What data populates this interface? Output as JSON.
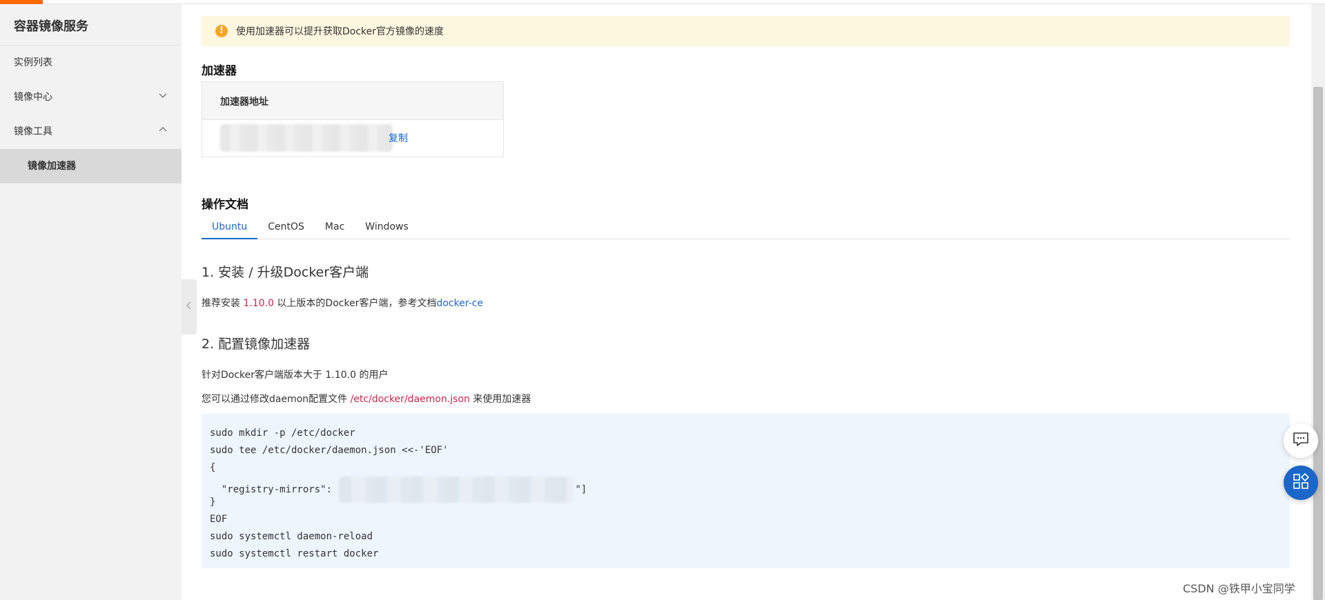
{
  "sidebar": {
    "title": "容器镜像服务",
    "items": [
      {
        "label": "实例列表"
      },
      {
        "label": "镜像中心",
        "chevron": "chevron-down-icon"
      },
      {
        "label": "镜像工具",
        "chevron": "chevron-up-icon"
      }
    ],
    "sub_item": "镜像加速器"
  },
  "alert": {
    "text": "使用加速器可以提升获取Docker官方镜像的速度",
    "icon": "!"
  },
  "accelerator": {
    "heading": "加速器",
    "table_header": "加速器地址",
    "copy_label": "复制"
  },
  "docs": {
    "heading": "操作文档",
    "tabs": [
      "Ubuntu",
      "CentOS",
      "Mac",
      "Windows"
    ],
    "step1": {
      "title": "1. 安装 / 升级Docker客户端",
      "prefix": "推荐安装 ",
      "version": "1.10.0",
      "middle": " 以上版本的Docker客户端，参考文档",
      "link": "docker-ce"
    },
    "step2": {
      "title": "2. 配置镜像加速器",
      "line1": "针对Docker客户端版本大于 1.10.0 的用户",
      "line2_prefix": "您可以通过修改daemon配置文件 ",
      "line2_path": "/etc/docker/daemon.json",
      "line2_suffix": " 来使用加速器"
    },
    "code": {
      "l1": "sudo mkdir -p /etc/docker",
      "l2": "sudo tee /etc/docker/daemon.json <<-'EOF'",
      "l3": "{",
      "l4_prefix": "  \"registry-mirrors\": ",
      "l4_suffix": "\"]",
      "l5": "}",
      "l6": "EOF",
      "l7": "sudo systemctl daemon-reload",
      "l8": "sudo systemctl restart docker"
    }
  },
  "watermark": "CSDN @铁甲小宝同学",
  "colors": {
    "accent": "#1a66c9",
    "brand": "#ff6a00",
    "alert_bg": "#fff8e1",
    "code_bg": "#eef5fc"
  }
}
